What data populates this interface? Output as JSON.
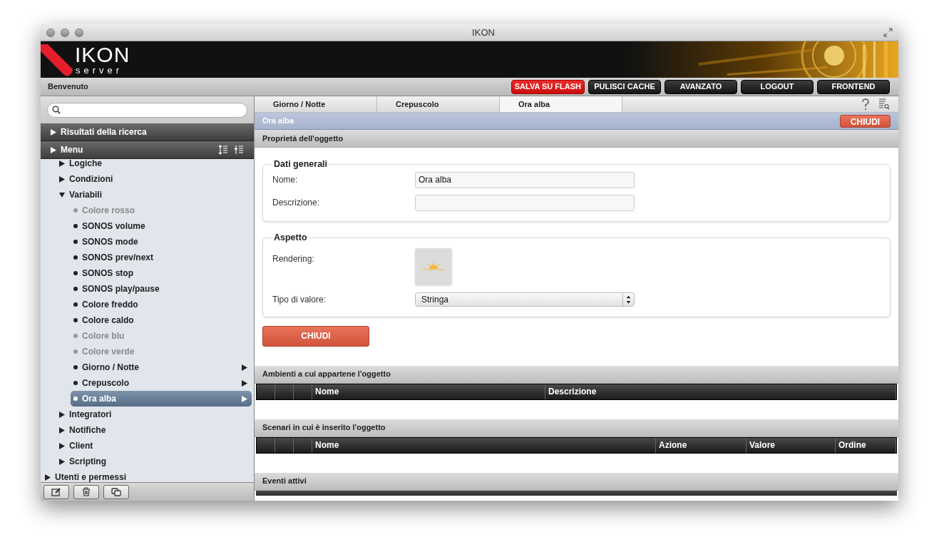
{
  "window": {
    "title": "IKON"
  },
  "logo": {
    "name": "IKON",
    "sub": "server"
  },
  "toolbar": {
    "welcome": "Benvenuto",
    "buttons": [
      {
        "label": "SALVA SU FLASH",
        "kind": "danger"
      },
      {
        "label": "PULISCI CACHE",
        "kind": "dark"
      },
      {
        "label": "AVANZATO",
        "kind": "dark"
      },
      {
        "label": "LOGOUT",
        "kind": "dark"
      },
      {
        "label": "FRONTEND",
        "kind": "dark"
      }
    ]
  },
  "sidebar": {
    "sections": [
      {
        "label": "Risultati della ricerca"
      },
      {
        "label": "Menu"
      }
    ],
    "tree": {
      "items": [
        {
          "label": "Logiche",
          "expanded": false
        },
        {
          "label": "Condizioni",
          "expanded": false
        },
        {
          "label": "Variabili",
          "expanded": true,
          "children": [
            {
              "label": "Colore rosso",
              "disabled": true,
              "has_submenu": false,
              "selected": false
            },
            {
              "label": "SONOS volume",
              "disabled": false,
              "has_submenu": false,
              "selected": false
            },
            {
              "label": "SONOS mode",
              "disabled": false,
              "has_submenu": false,
              "selected": false
            },
            {
              "label": "SONOS prev/next",
              "disabled": false,
              "has_submenu": false,
              "selected": false
            },
            {
              "label": "SONOS stop",
              "disabled": false,
              "has_submenu": false,
              "selected": false
            },
            {
              "label": "SONOS play/pause",
              "disabled": false,
              "has_submenu": false,
              "selected": false
            },
            {
              "label": "Colore freddo",
              "disabled": false,
              "has_submenu": false,
              "selected": false
            },
            {
              "label": "Colore caldo",
              "disabled": false,
              "has_submenu": false,
              "selected": false
            },
            {
              "label": "Colore blu",
              "disabled": true,
              "has_submenu": false,
              "selected": false
            },
            {
              "label": "Colore verde",
              "disabled": true,
              "has_submenu": false,
              "selected": false
            },
            {
              "label": "Giorno / Notte",
              "disabled": false,
              "has_submenu": true,
              "selected": false
            },
            {
              "label": "Crepuscolo",
              "disabled": false,
              "has_submenu": true,
              "selected": false
            },
            {
              "label": "Ora alba",
              "disabled": false,
              "has_submenu": true,
              "selected": true
            }
          ]
        },
        {
          "label": "Integratori",
          "expanded": false
        },
        {
          "label": "Notifiche",
          "expanded": false
        },
        {
          "label": "Client",
          "expanded": false
        },
        {
          "label": "Scripting",
          "expanded": false
        }
      ],
      "following_top_level_items": [
        {
          "label": "Utenti e permessi",
          "expanded": false
        }
      ]
    }
  },
  "tabs": [
    {
      "label": "Giorno / Notte",
      "selected": false
    },
    {
      "label": "Crepuscolo",
      "selected": false
    },
    {
      "label": "Ora alba",
      "selected": true
    }
  ],
  "object_bar": {
    "title": "Ora alba",
    "close": "CHIUDI"
  },
  "properties": {
    "title": "Proprietà dell'oggetto",
    "general": {
      "legend": "Dati generali",
      "name_label": "Nome:",
      "name_value": "Ora alba",
      "description_label": "Descrizione:"
    },
    "appearance": {
      "legend": "Aspetto",
      "rendering_label": "Rendering:",
      "value_type_label": "Tipo di valore:",
      "value_type": "Stringa"
    },
    "close": "CHIUDI"
  },
  "tables": [
    {
      "title": "Ambienti a cui appartene l'oggetto",
      "columns": [
        "Nome",
        "Descrizione"
      ]
    },
    {
      "title": "Scenari in cui è inserito l'oggetto",
      "columns": [
        "Nome",
        "Azione",
        "Valore",
        "Ordine"
      ]
    },
    {
      "title": "Eventi attivi"
    }
  ]
}
